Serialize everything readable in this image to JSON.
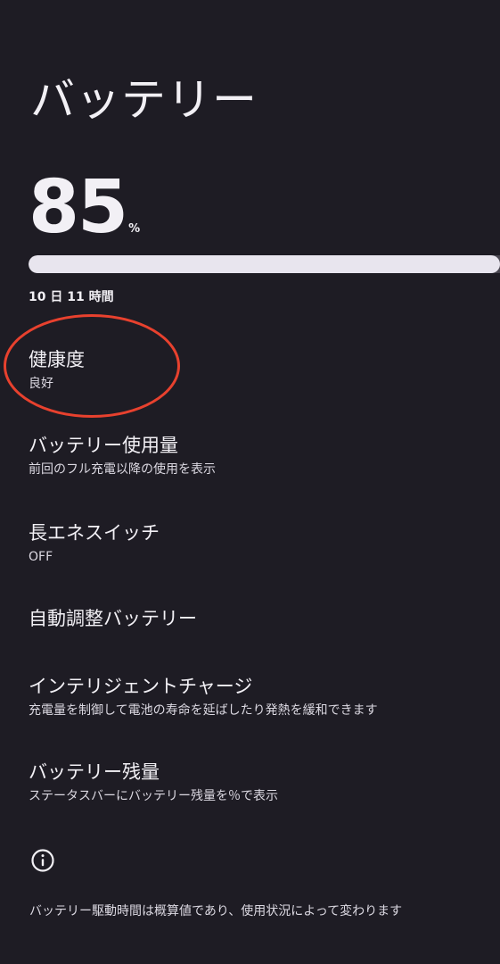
{
  "header": {
    "title": "バッテリー"
  },
  "battery": {
    "level": "85",
    "unit": "%",
    "level_fraction": 0.85,
    "time_remaining": "10 日 11 時間"
  },
  "items": [
    {
      "title": "健康度",
      "subtitle": "良好"
    },
    {
      "title": "バッテリー使用量",
      "subtitle": "前回のフル充電以降の使用を表示"
    },
    {
      "title": "長エネスイッチ",
      "subtitle": "OFF"
    },
    {
      "title": "自動調整バッテリー",
      "subtitle": ""
    },
    {
      "title": "インテリジェントチャージ",
      "subtitle": "充電量を制御して電池の寿命を延ばしたり発熱を緩和できます"
    },
    {
      "title": "バッテリー残量",
      "subtitle": "ステータスバーにバッテリー残量を％で表示"
    }
  ],
  "footer": {
    "icon": "info-icon",
    "note": "バッテリー駆動時間は概算値であり、使用状況によって変わります"
  },
  "colors": {
    "background": "#1e1c24",
    "bar_fill": "#e8e5ee",
    "annotation": "#e8412e"
  }
}
